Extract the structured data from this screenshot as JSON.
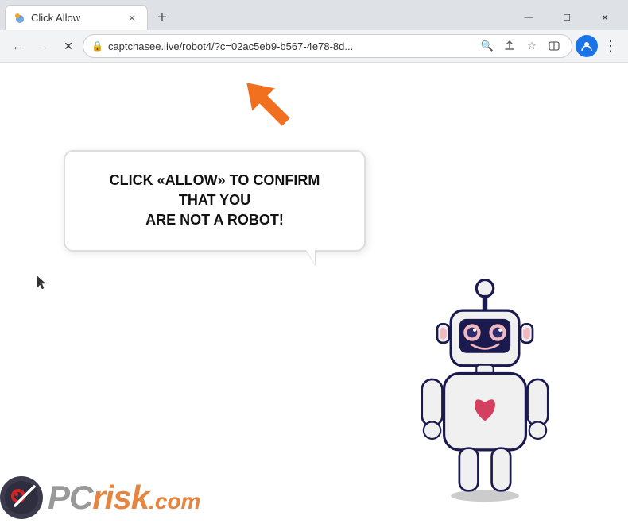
{
  "browser": {
    "tab": {
      "label": "Click Allow",
      "favicon": "moon-icon"
    },
    "new_tab_label": "+",
    "window_controls": {
      "minimize": "—",
      "maximize": "☐",
      "close": "✕"
    },
    "nav": {
      "back": "←",
      "forward": "→",
      "reload": "✕",
      "lock_icon": "🔒",
      "url": "captchasee.live/robot4/?c=02ac5eb9-b567-4e78-8d...",
      "search_icon": "🔍",
      "share_icon": "⬆",
      "bookmark_icon": "☆",
      "split_icon": "▭",
      "profile_icon": "👤",
      "more_icon": "⋮"
    }
  },
  "page": {
    "speech_bubble_line1": "CLICK «ALLOW» TO CONFIRM THAT YOU",
    "speech_bubble_line2": "ARE NOT A ROBOT!",
    "arrow_color": "#F07020",
    "pcrisk_text": "PC",
    "pcrisk_suffix": "risk",
    "pcrisk_domain": ".com"
  }
}
